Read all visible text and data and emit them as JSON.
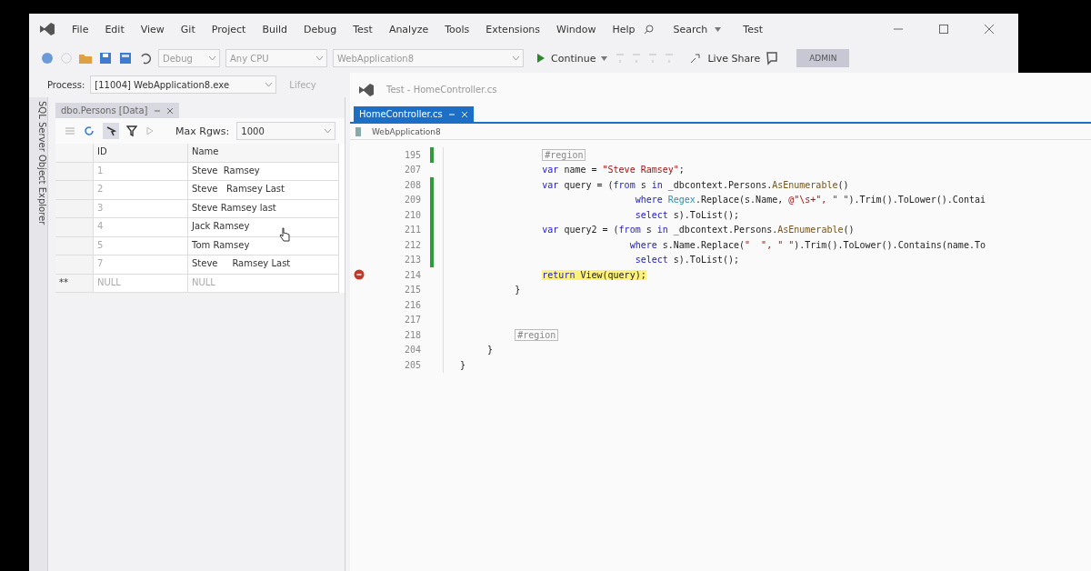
{
  "main_window": {
    "menu": [
      "File",
      "Edit",
      "View",
      "Git",
      "Project",
      "Build",
      "Debug",
      "Test",
      "Analyze",
      "Tools",
      "Extensions",
      "Window",
      "Help"
    ],
    "search": "Search",
    "solution_name": "Test",
    "toolbar": {
      "configuration": "Debug",
      "platform": "Any CPU",
      "startup_project": "WebApplication8",
      "continue": "Continue",
      "live_share": "Live Share",
      "admin": "ADMIN"
    },
    "process_label": "Process:",
    "process": "[11004] WebApplication8.exe",
    "lifecycle": "Lifecy"
  },
  "side_tab": "SQL Server Object Explorer",
  "data_panel": {
    "tab": "dbo.Persons [Data]",
    "max_rows_label": "Max Rgws:",
    "max_rows": "1000",
    "columns": [
      "ID",
      "Name"
    ],
    "rows": [
      {
        "id": "1",
        "name": "Steve  Ramsey",
        "kind": "value"
      },
      {
        "id": "2",
        "name": "Steve   Ramsey Last",
        "kind": "value"
      },
      {
        "id": "3",
        "name": "Steve Ramsey last",
        "kind": "value"
      },
      {
        "id": "4",
        "name": "Jack Ramsey",
        "kind": "value"
      },
      {
        "id": "5",
        "name": "Tom Ramsey",
        "kind": "value"
      },
      {
        "id": "7",
        "name": "Steve     Ramsey Last",
        "kind": "value"
      },
      {
        "marker": "**",
        "id": "NULL",
        "name": "NULL",
        "kind": "null"
      }
    ]
  },
  "editor": {
    "title": "Test - HomeController.cs",
    "tabs": [
      {
        "label": "HomeController.cs",
        "selected": true
      }
    ],
    "nav": "WebApplication8",
    "lines": [
      {
        "number": "195",
        "kind": "body",
        "changed": true,
        "breakpoint": false,
        "current": false,
        "segments": [
          {
            "kind": "region",
            "text": "#region"
          }
        ]
      },
      {
        "number": "207",
        "kind": "body",
        "changed": false,
        "breakpoint": false,
        "current": false,
        "segments": [
          {
            "kind": "keyword",
            "text": "var"
          },
          {
            "kind": "plain",
            "text": " name = "
          },
          {
            "kind": "string",
            "text": "\"Steve Ramsey\""
          },
          {
            "kind": "plain",
            "text": ";"
          }
        ]
      },
      {
        "number": "208",
        "kind": "body",
        "changed": true,
        "breakpoint": false,
        "current": false,
        "segments": [
          {
            "kind": "keyword",
            "text": "var"
          },
          {
            "kind": "plain",
            "text": " query = ("
          },
          {
            "kind": "keyword",
            "text": "from"
          },
          {
            "kind": "plain",
            "text": " s "
          },
          {
            "kind": "keyword",
            "text": "in"
          },
          {
            "kind": "plain",
            "text": " _dbcontext.Persons."
          },
          {
            "kind": "method",
            "text": "AsEnumerable"
          },
          {
            "kind": "plain",
            "text": "()"
          }
        ]
      },
      {
        "number": "209",
        "kind": "query",
        "changed": true,
        "breakpoint": false,
        "current": false,
        "segments": [
          {
            "kind": "keyword",
            "text": "where"
          },
          {
            "kind": "type",
            "text": " Regex"
          },
          {
            "kind": "plain",
            "text": ".Replace(s.Name, "
          },
          {
            "kind": "string",
            "text": "@\"\\s+\", \" \""
          },
          {
            "kind": "plain",
            "text": ").Trim().ToLower().Contai"
          }
        ]
      },
      {
        "number": "210",
        "kind": "query",
        "changed": true,
        "breakpoint": false,
        "current": false,
        "segments": [
          {
            "kind": "keyword",
            "text": "select"
          },
          {
            "kind": "plain",
            "text": " s).ToList();"
          }
        ]
      },
      {
        "number": "211",
        "kind": "body",
        "changed": true,
        "breakpoint": false,
        "current": false,
        "segments": [
          {
            "kind": "keyword",
            "text": "var"
          },
          {
            "kind": "plain",
            "text": " query2 = ("
          },
          {
            "kind": "keyword",
            "text": "from"
          },
          {
            "kind": "plain",
            "text": " s "
          },
          {
            "kind": "keyword",
            "text": "in"
          },
          {
            "kind": "plain",
            "text": " _dbcontext.Persons."
          },
          {
            "kind": "method",
            "text": "AsEnumerable"
          },
          {
            "kind": "plain",
            "text": "()"
          }
        ]
      },
      {
        "number": "212",
        "kind": "query2",
        "changed": true,
        "breakpoint": false,
        "current": false,
        "segments": [
          {
            "kind": "keyword",
            "text": "where"
          },
          {
            "kind": "plain",
            "text": " s.Name.Replace("
          },
          {
            "kind": "string",
            "text": "\"  \", \" \""
          },
          {
            "kind": "plain",
            "text": ").Trim().ToLower().Contains(name.To"
          }
        ]
      },
      {
        "number": "213",
        "kind": "query",
        "changed": true,
        "breakpoint": false,
        "current": false,
        "segments": [
          {
            "kind": "keyword",
            "text": "select"
          },
          {
            "kind": "plain",
            "text": " s).ToList();"
          }
        ]
      },
      {
        "number": "214",
        "kind": "body",
        "changed": false,
        "breakpoint": true,
        "current": true,
        "segments": [
          {
            "kind": "keyword",
            "text": "return"
          },
          {
            "kind": "plain",
            "text": " View(query);"
          }
        ]
      },
      {
        "number": "215",
        "kind": "method_end",
        "changed": false,
        "breakpoint": false,
        "current": false,
        "segments": [
          {
            "kind": "plain",
            "text": "}"
          }
        ]
      },
      {
        "number": "216",
        "kind": "body",
        "changed": false,
        "breakpoint": false,
        "current": false
      },
      {
        "number": "217",
        "kind": "body",
        "changed": false,
        "breakpoint": false,
        "current": false
      },
      {
        "number": "218",
        "kind": "method_end",
        "changed": false,
        "breakpoint": false,
        "current": false,
        "segments": [
          {
            "kind": "region",
            "text": "#region"
          }
        ]
      },
      {
        "number": "204",
        "kind": "class_end",
        "changed": false,
        "breakpoint": false,
        "current": false,
        "segments": [
          {
            "kind": "plain",
            "text": "}"
          }
        ]
      },
      {
        "number": "205",
        "kind": "namespace_end",
        "changed": false,
        "breakpoint": false,
        "current": false,
        "segments": [
          {
            "kind": "plain",
            "text": "}"
          }
        ]
      }
    ]
  }
}
